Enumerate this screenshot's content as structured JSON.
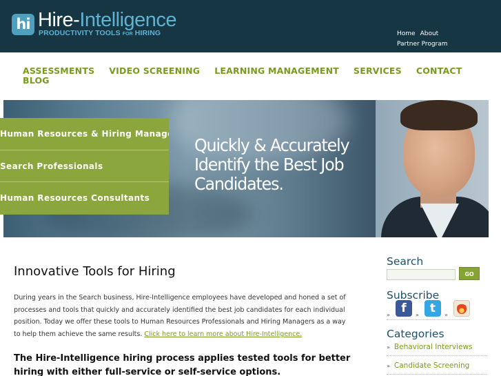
{
  "header": {
    "logo_badge": "hi",
    "logo_name_a": "Hire-",
    "logo_name_b": "Intelligence",
    "tagline_a": "PRODUCTIVITY TOOLS ",
    "tagline_small": "FOR",
    "tagline_b": " HIRING",
    "utility_links": [
      "Home",
      "About",
      "Partner Program"
    ]
  },
  "nav": {
    "items": [
      "ASSESSMENTS",
      "VIDEO SCREENING",
      "LEARNING MANAGEMENT",
      "SERVICES",
      "CONTACT",
      "BLOG"
    ]
  },
  "hero": {
    "headline": "Quickly & Accurately Identify the Best Job Candidates.",
    "menu": [
      "Human Resources & Hiring Managers",
      "Search Professionals",
      "Human Resources Consultants"
    ]
  },
  "content": {
    "title": "Innovative Tools for Hiring",
    "paragraph": "During years in the Search business, Hire-Intelligence employees have developed and honed a set of processes and tools that quickly and accurately identified the best job candidates for each individual position. Today we offer these tools to Human Resources Professionals and Hiring Managers as a way to help them achieve the same results. ",
    "link": "Click here to learn more about Hire-Intelligence.",
    "bold": "The Hire-Intelligence hiring process applies tested tools for better hiring with either full-service or self-service options."
  },
  "sidebar": {
    "search_heading": "Search",
    "search_value": "",
    "go_label": "GO",
    "subscribe_heading": "Subscribe",
    "social_chevron": "»",
    "social_icons": [
      "facebook-icon",
      "twitter-icon",
      "rss-feed-icon"
    ],
    "categories_heading": "Categories",
    "categories": [
      "Behavioral Interviews",
      "Candidate Screening"
    ]
  },
  "colors": {
    "header_bg": "#163643",
    "accent_green": "#7a9a1c",
    "menu_green": "#8aa63c",
    "logo_blue": "#5fb2d3"
  }
}
